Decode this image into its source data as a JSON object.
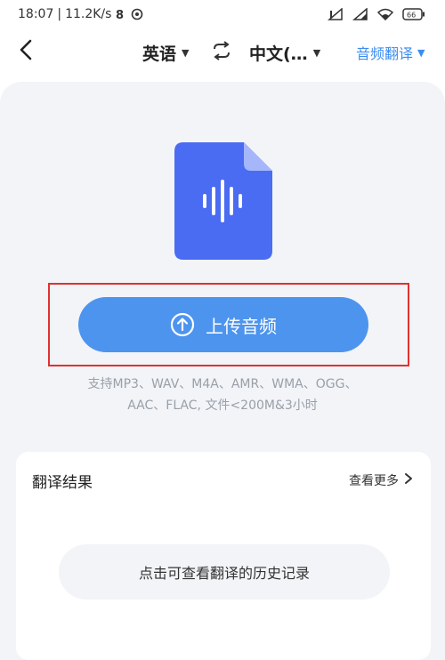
{
  "status_bar": {
    "time": "18:07",
    "net_speed": "11.2K/s",
    "battery": "66",
    "icons": [
      "data-saver-icon",
      "sync-icon",
      "signal-icon",
      "signal-icon",
      "wifi-icon",
      "battery-icon"
    ]
  },
  "header": {
    "back_icon": "chevron-left-icon",
    "source_lang": "英语",
    "swap_icon": "swap-icon",
    "target_lang": "中文(…",
    "mode_label": "音频翻译",
    "caret": "▼"
  },
  "upload": {
    "icon": "upload-arrow-icon",
    "label": "上传音频",
    "file_icon": "audio-file-icon",
    "formats_line1": "支持MP3、WAV、M4A、AMR、WMA、OGG、",
    "formats_line2": "AAC、FLAC, 文件<200M&3小时"
  },
  "result": {
    "title": "翻译结果",
    "more_label": "查看更多",
    "more_icon": "chevron-right-icon",
    "history_label": "点击可查看翻译的历史记录"
  },
  "colors": {
    "accent": "#4d94ee",
    "link": "#3d8df0",
    "highlight_frame": "#e0312f",
    "file_icon_body": "#4a6cf2",
    "panel_bg": "#f2f4f8"
  }
}
